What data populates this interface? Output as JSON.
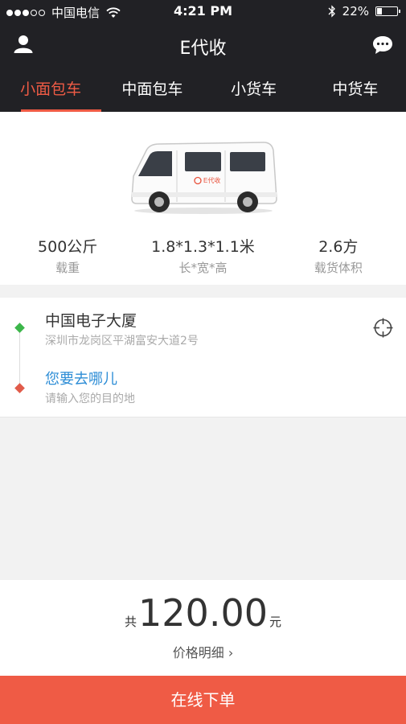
{
  "status_bar": {
    "carrier": "中国电信",
    "time": "4:21 PM",
    "battery_text": "22%",
    "battery_level": 0.22,
    "signal_strength": 3
  },
  "header": {
    "title": "E代收",
    "left_icon": "user-icon",
    "right_icon": "chat-icon"
  },
  "tabs": [
    {
      "label": "小面包车",
      "active": true
    },
    {
      "label": "中面包车",
      "active": false
    },
    {
      "label": "小货车",
      "active": false
    },
    {
      "label": "中货车",
      "active": false
    }
  ],
  "vehicle": {
    "brand_text": "E代收",
    "specs": [
      {
        "value": "500公斤",
        "label": "载重"
      },
      {
        "value": "1.8*1.3*1.1米",
        "label": "长*宽*高"
      },
      {
        "value": "2.6方",
        "label": "载货体积"
      }
    ]
  },
  "route": {
    "from_name": "中国电子大厦",
    "from_address": "深圳市龙岗区平湖富安大道2号",
    "to_name": "您要去哪儿",
    "to_hint": "请输入您的目的地"
  },
  "price": {
    "prefix": "共",
    "amount": "120.00",
    "unit": "元",
    "detail_label": "价格明细 ›"
  },
  "order_button": "在线下单",
  "colors": {
    "header_bg": "#212125",
    "accent": "#ef5b45",
    "link_blue": "#2d8dd6",
    "start_green": "#3cb64a",
    "end_red": "#e15b4a"
  }
}
